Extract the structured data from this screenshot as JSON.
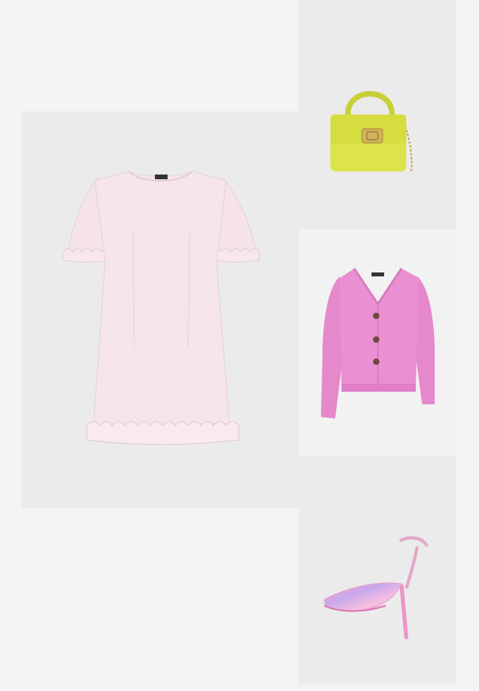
{
  "products": [
    {
      "name": "pink-ruffle-mini-dress",
      "color": "#f6e4e8"
    },
    {
      "name": "lime-yellow-top-handle-bag",
      "color": "#dde44a"
    },
    {
      "name": "pink-knit-cardigan",
      "color": "#e889cf"
    },
    {
      "name": "pink-tie-dye-mesh-slingback-heel",
      "color": "#ecb3d9"
    }
  ],
  "background_color": "#f4f4f4"
}
